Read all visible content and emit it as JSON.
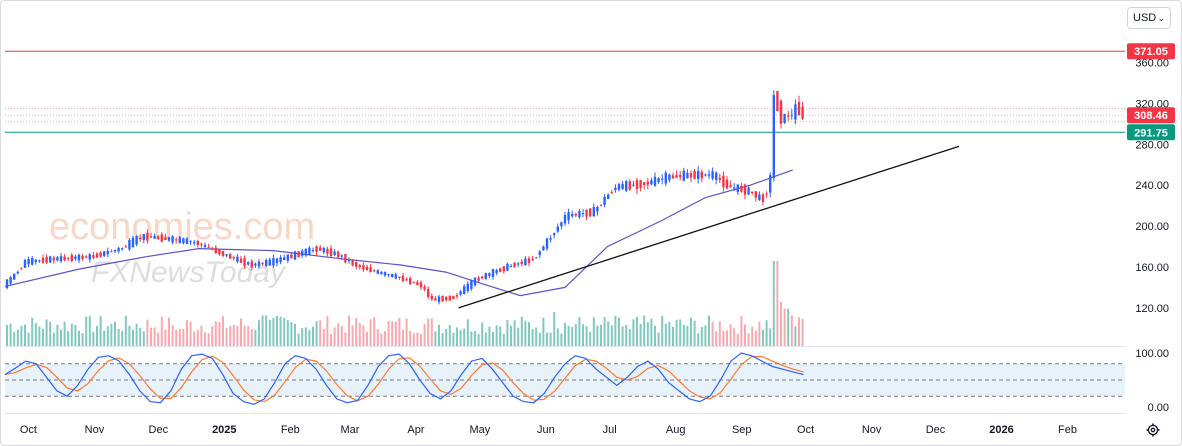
{
  "toolbar": {
    "currency": "USD"
  },
  "colors": {
    "up": "#2962ff",
    "down": "#f23645",
    "ma": "#5b53c7",
    "trend": "#111111",
    "resistance": "#f23645",
    "support": "#089981",
    "volume_up": "#7fc9c0",
    "volume_down": "#f7a9ae",
    "stoch_k": "#2962ff",
    "stoch_d": "#ff7a2f",
    "stoch_band": "#e8f2fb"
  },
  "icons": {
    "settings": "gear-icon",
    "currency_dropdown": "chevron-down-icon"
  },
  "watermark": {
    "line1": "economies.com",
    "line2": "FXNewsToday"
  },
  "chart_data": [
    {
      "type": "candlestick",
      "price_axis": {
        "ticks": [
          "360.00",
          "320.00",
          "280.00",
          "240.00",
          "200.00",
          "160.00",
          "120.00"
        ],
        "ylim": [
          105,
          400
        ]
      },
      "time_axis": {
        "labels": [
          "Oct",
          "Nov",
          "Dec",
          "2025",
          "Feb",
          "Mar",
          "Apr",
          "May",
          "Jun",
          "Jul",
          "Aug",
          "Sep",
          "Oct",
          "Nov",
          "Dec",
          "2026",
          "Feb"
        ],
        "bold": [
          "2025",
          "2026"
        ]
      },
      "levels": [
        {
          "name": "resistance",
          "value": 371.05,
          "label": "371.05"
        },
        {
          "name": "last-price",
          "value": 308.46,
          "label": "308.46"
        },
        {
          "name": "support",
          "value": 291.75,
          "label": "291.75"
        }
      ],
      "dotted_band": [
        302,
        315
      ],
      "trendline": {
        "from": [
          "2025-04-21",
          120
        ],
        "to": [
          "2025-12-12",
          278
        ]
      },
      "moving_average": [
        [
          "2024-09-20",
          141
        ],
        [
          "2024-10-25",
          158
        ],
        [
          "2024-11-25",
          170
        ],
        [
          "2024-12-20",
          178
        ],
        [
          "2025-01-24",
          176
        ],
        [
          "2025-02-25",
          168
        ],
        [
          "2025-03-25",
          162
        ],
        [
          "2025-04-15",
          155
        ],
        [
          "2025-04-30",
          145
        ],
        [
          "2025-05-20",
          132
        ],
        [
          "2025-06-10",
          140
        ],
        [
          "2025-06-30",
          180
        ],
        [
          "2025-07-25",
          205
        ],
        [
          "2025-08-15",
          228
        ],
        [
          "2025-09-05",
          240
        ],
        [
          "2025-09-25",
          255
        ]
      ],
      "price_path": [
        [
          "2024-09-20",
          140
        ],
        [
          "2024-09-25",
          150
        ],
        [
          "2024-10-01",
          165
        ],
        [
          "2024-10-15",
          168
        ],
        [
          "2024-11-01",
          170
        ],
        [
          "2024-11-15",
          178
        ],
        [
          "2024-11-25",
          190
        ],
        [
          "2024-12-05",
          188
        ],
        [
          "2024-12-20",
          184
        ],
        [
          "2025-01-05",
          170
        ],
        [
          "2025-01-15",
          162
        ],
        [
          "2025-01-25",
          165
        ],
        [
          "2025-02-05",
          172
        ],
        [
          "2025-02-15",
          178
        ],
        [
          "2025-02-25",
          172
        ],
        [
          "2025-03-05",
          162
        ],
        [
          "2025-03-15",
          155
        ],
        [
          "2025-03-25",
          150
        ],
        [
          "2025-04-05",
          142
        ],
        [
          "2025-04-10",
          128
        ],
        [
          "2025-04-20",
          130
        ],
        [
          "2025-05-01",
          148
        ],
        [
          "2025-05-15",
          160
        ],
        [
          "2025-05-28",
          168
        ],
        [
          "2025-06-05",
          190
        ],
        [
          "2025-06-12",
          210
        ],
        [
          "2025-06-25",
          214
        ],
        [
          "2025-07-05",
          238
        ],
        [
          "2025-07-20",
          242
        ],
        [
          "2025-07-30",
          248
        ],
        [
          "2025-08-10",
          250
        ],
        [
          "2025-08-20",
          250
        ],
        [
          "2025-08-28",
          238
        ],
        [
          "2025-09-03",
          236
        ],
        [
          "2025-09-08",
          232
        ],
        [
          "2025-09-12",
          225
        ],
        [
          "2025-09-16",
          242
        ],
        [
          "2025-09-17",
          332
        ],
        [
          "2025-09-19",
          320
        ],
        [
          "2025-09-22",
          300
        ],
        [
          "2025-09-24",
          312
        ],
        [
          "2025-09-26",
          306
        ],
        [
          "2025-09-29",
          322
        ],
        [
          "2025-09-30",
          308
        ]
      ],
      "volume_spikes": [
        [
          "2024-12-12",
          0.5
        ],
        [
          "2025-01-20",
          0.9
        ],
        [
          "2025-06-05",
          1.0
        ],
        [
          "2025-06-25",
          0.6
        ],
        [
          "2025-07-10",
          0.5
        ],
        [
          "2025-09-17",
          2.5
        ],
        [
          "2025-09-19",
          1.3
        ],
        [
          "2025-09-22",
          1.1
        ],
        [
          "2025-09-24",
          0.9
        ],
        [
          "2025-09-29",
          0.8
        ]
      ]
    },
    {
      "type": "stochastic-oscillator",
      "ticks": [
        "100.00",
        "0.00"
      ],
      "ylim": [
        -10,
        110
      ],
      "band": [
        20,
        80
      ],
      "k_values": [
        60,
        72,
        85,
        80,
        55,
        30,
        20,
        40,
        70,
        92,
        95,
        85,
        60,
        30,
        10,
        8,
        30,
        70,
        95,
        98,
        90,
        60,
        25,
        10,
        5,
        15,
        45,
        80,
        95,
        90,
        70,
        40,
        15,
        8,
        12,
        40,
        75,
        95,
        98,
        80,
        50,
        25,
        15,
        30,
        60,
        85,
        90,
        70,
        45,
        20,
        10,
        8,
        25,
        55,
        80,
        95,
        90,
        70,
        55,
        40,
        55,
        75,
        85,
        70,
        45,
        30,
        15,
        10,
        20,
        50,
        85,
        100,
        95,
        85,
        75,
        70,
        65,
        60
      ]
    }
  ]
}
